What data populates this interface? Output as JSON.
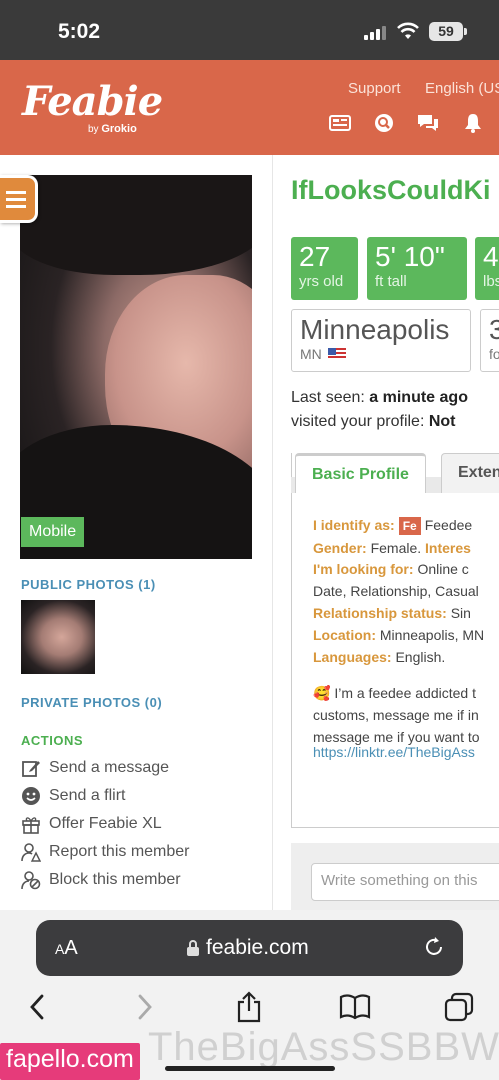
{
  "status_bar": {
    "time": "5:02",
    "battery": "59"
  },
  "header": {
    "logo": "Feabie",
    "logo_by": "by",
    "logo_company": "Grokio",
    "links": [
      "Support",
      "English (US"
    ],
    "icons": [
      "news-icon",
      "search-icon",
      "chat-icon",
      "notification-icon",
      "user-icon"
    ]
  },
  "left": {
    "mobile_badge": "Mobile",
    "public_photos_title": "PUBLIC PHOTOS (1)",
    "private_photos_title": "PRIVATE PHOTOS (0)",
    "actions_title": "ACTIONS",
    "actions": [
      {
        "icon": "edit-icon",
        "label": "Send a message"
      },
      {
        "icon": "smiley-icon",
        "label": "Send a flirt"
      },
      {
        "icon": "gift-icon",
        "label": "Offer Feabie XL"
      },
      {
        "icon": "report-user-icon",
        "label": "Report this member"
      },
      {
        "icon": "block-user-icon",
        "label": "Block this member"
      }
    ]
  },
  "profile": {
    "username": "IfLooksCouldKi",
    "age": {
      "value": "27",
      "label": "yrs old"
    },
    "height": {
      "value": "5' 10\"",
      "label": "ft tall"
    },
    "weight": {
      "value": "4",
      "label": "lbs"
    },
    "city": "Minneapolis",
    "state": "MN",
    "followers": {
      "value": "3",
      "label": "fo"
    },
    "last_seen_label": "Last seen:",
    "last_seen_value": "a minute ago",
    "visited_label": "visited your profile:",
    "visited_value": "Not",
    "tabs": [
      "Basic Profile",
      "Exten"
    ],
    "basic": {
      "identify_label": "I identify as:",
      "identify_badge": "Fe",
      "identify_value": "Feedee",
      "gender_label": "Gender:",
      "gender_value": "Female.",
      "interested_label": "Interes",
      "looking_label": "I'm looking for:",
      "looking_value": "Online c",
      "looking_value2": "Date, Relationship, Casual",
      "relationship_label": "Relationship status:",
      "relationship_value": "Sin",
      "location_label": "Location:",
      "location_value": "Minneapolis, MN",
      "languages_label": "Languages:",
      "languages_value": "English."
    },
    "bio": [
      "🥰 I’m a feedee addicted t",
      "customs, message me if in",
      "message me if you want to"
    ],
    "link": "https://linktr.ee/TheBigAss",
    "comment_placeholder": "Write something on this"
  },
  "browser": {
    "aa_small": "A",
    "aa_big": "A",
    "url": "feabie.com"
  },
  "watermark": "TheBigAssSSBBW",
  "site_badge": "fapello.com",
  "colors": {
    "brand": "#d9674a",
    "green": "#5cb85c",
    "label_orange": "#d8973c"
  }
}
